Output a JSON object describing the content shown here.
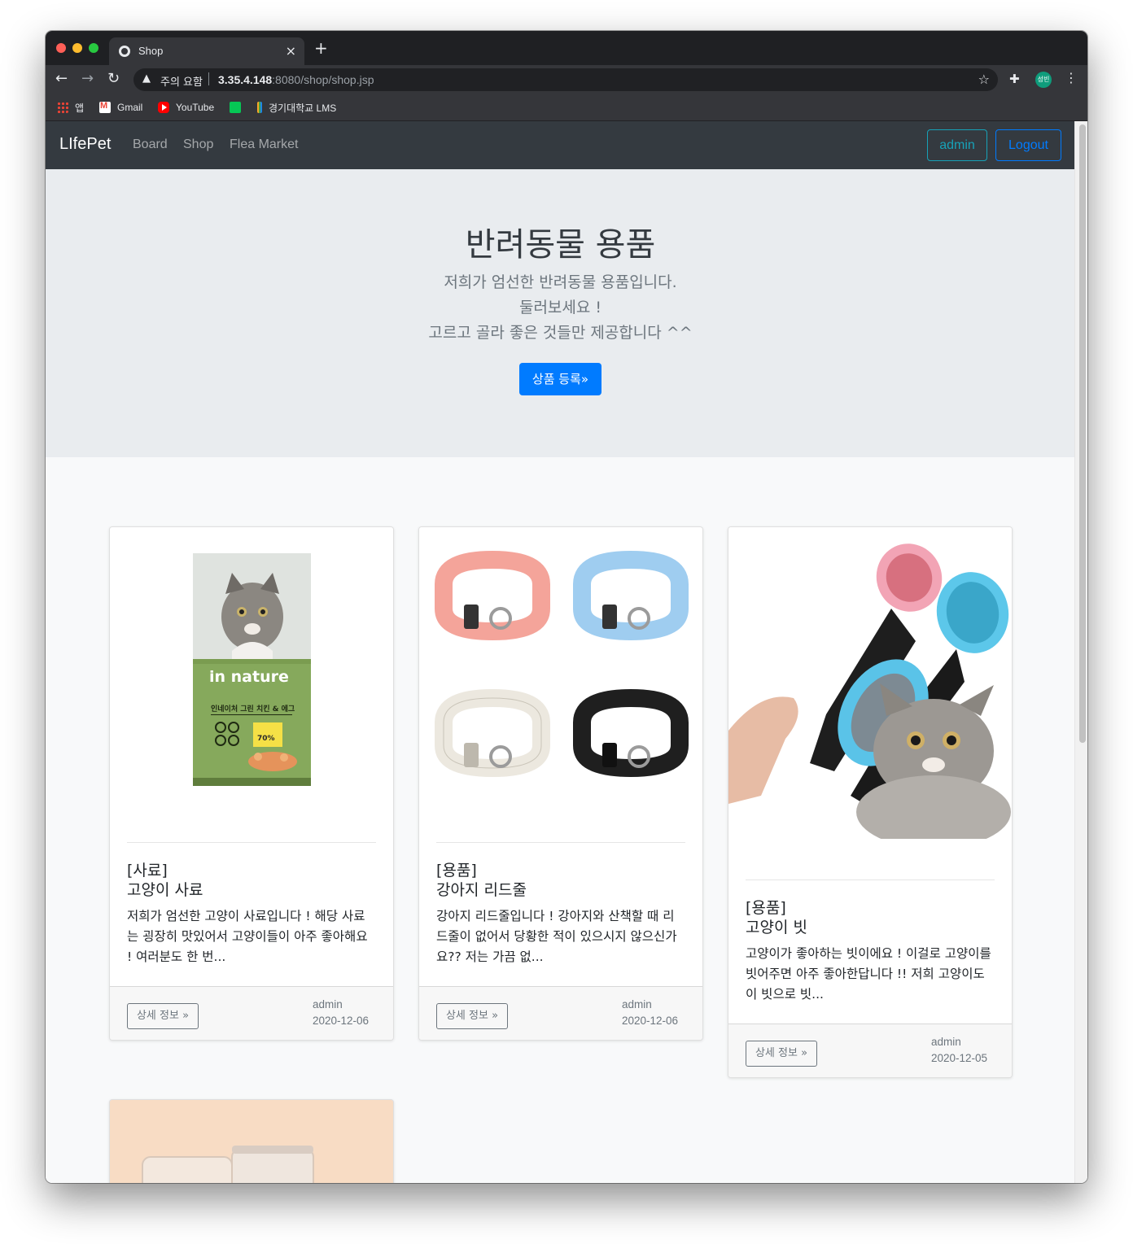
{
  "browser": {
    "tab_title": "Shop",
    "new_tab": "+",
    "tab_close": "×",
    "security_label": "주의 요함",
    "url_host": "3.35.4.148",
    "url_rest": ":8080/shop/shop.jsp",
    "profile_label": "성빈",
    "bookmarks": [
      {
        "label": "앱",
        "icon": "apps-icon"
      },
      {
        "label": "Gmail",
        "icon": "gmail-icon"
      },
      {
        "label": "YouTube",
        "icon": "youtube-icon"
      },
      {
        "label": "",
        "icon": "line-icon"
      },
      {
        "label": "경기대학교 LMS",
        "icon": "lms-icon"
      }
    ]
  },
  "navbar": {
    "brand": "LIfePet",
    "links": [
      "Board",
      "Shop",
      "Flea Market"
    ],
    "admin_label": "admin",
    "logout_label": "Logout"
  },
  "hero": {
    "title": "반려동물 용품",
    "lines": [
      "저희가 엄선한 반려동물 용품입니다.",
      "둘러보세요 !",
      "고르고 골라 좋은 것들만 제공합니다 ^^"
    ],
    "button": "상품 등록»"
  },
  "products": [
    {
      "category": "[사료]",
      "name": "고양이 사료",
      "description": "저희가 엄선한 고양이 사료입니다 ! 해당 사료는 굉장히 맛있어서 고양이들이 아주 좋아해요 ! 여러분도 한 번...",
      "package_brand": "in nature",
      "package_text": "인네이처 그린 치킨 & 에그",
      "package_badge": "70%",
      "detail_label": "상세 정보 »",
      "author": "admin",
      "date": "2020-12-06"
    },
    {
      "category": "[용품]",
      "name": "강아지 리드줄",
      "description": "강아지 리드줄입니다 ! 강아지와 산책할 때 리드줄이 없어서 당황한 적이 있으시지 않으신가요?? 저는 가끔 없...",
      "detail_label": "상세 정보 »",
      "author": "admin",
      "date": "2020-12-06"
    },
    {
      "category": "[용품]",
      "name": "고양이 빗",
      "description": "고양이가 좋아하는 빗이에요 ! 이걸로 고양이를 빗어주면 아주 좋아한답니다 !! 저희 고양이도 이 빗으로 빗...",
      "detail_label": "상세 정보 »",
      "author": "admin",
      "date": "2020-12-05"
    }
  ],
  "colors": {
    "navbar_bg": "#343a40",
    "jumbotron_bg": "#e9ecef",
    "primary": "#007bff",
    "info": "#17a2b8",
    "collar_colors": [
      "#f4a49a",
      "#9fcdf0",
      "#ece8df",
      "#1f1f1f"
    ]
  }
}
